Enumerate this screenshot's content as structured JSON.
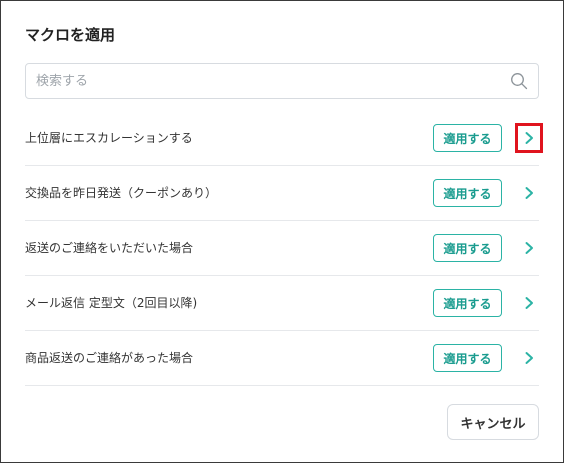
{
  "dialog": {
    "title": "マクロを適用"
  },
  "search": {
    "placeholder": "検索する",
    "icon": "search-icon"
  },
  "macros": [
    {
      "label": "上位層にエスカレーションする",
      "apply_label": "適用する",
      "highlighted": true
    },
    {
      "label": "交換品を昨日発送（クーポンあり）",
      "apply_label": "適用する",
      "highlighted": false
    },
    {
      "label": "返送のご連絡をいただいた場合",
      "apply_label": "適用する",
      "highlighted": false
    },
    {
      "label": "メール返信 定型文（2回目以降)",
      "apply_label": "適用する",
      "highlighted": false
    },
    {
      "label": "商品返送のご連絡があった場合",
      "apply_label": "適用する",
      "highlighted": false
    }
  ],
  "footer": {
    "cancel_label": "キャンセル"
  },
  "colors": {
    "accent": "#2bb3a5",
    "highlight_border": "#e0141e"
  }
}
